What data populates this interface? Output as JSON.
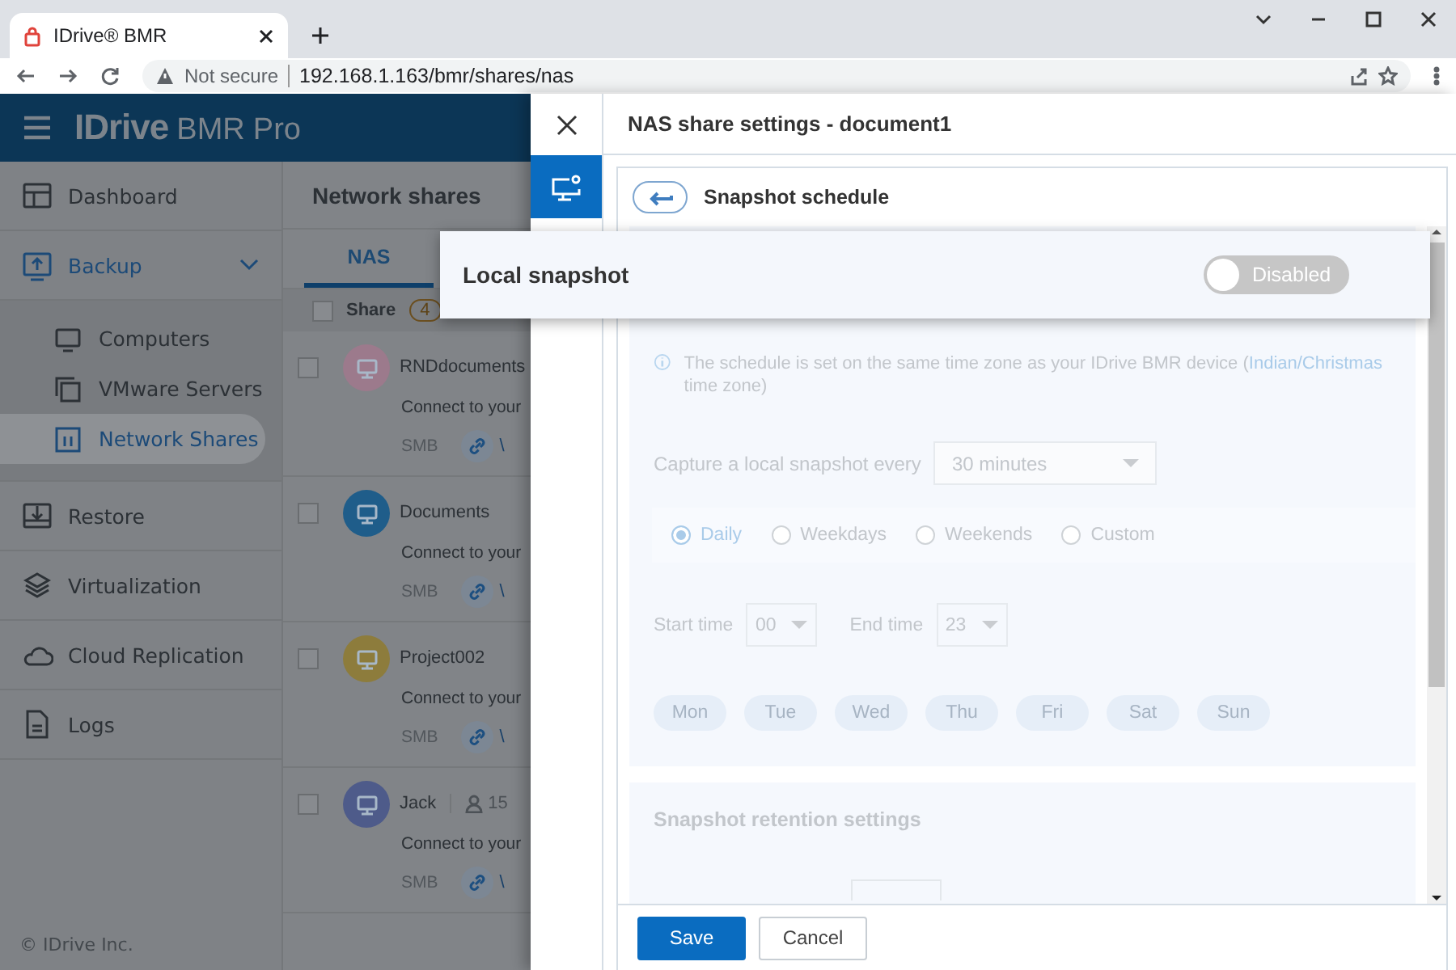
{
  "browser": {
    "tab_title": "IDrive® BMR",
    "security": "Not secure",
    "url": "192.168.1.163/bmr/shares/nas"
  },
  "app": {
    "logo": {
      "brand": "IDrive",
      "product": "BMR",
      "edition": "Pro"
    }
  },
  "sidebar": {
    "items": [
      {
        "label": "Dashboard",
        "selected": false
      },
      {
        "label": "Backup",
        "selected": true,
        "expanded": true,
        "children": [
          {
            "label": "Computers",
            "selected": false
          },
          {
            "label": "VMware Servers",
            "selected": false
          },
          {
            "label": "Network Shares",
            "selected": true
          }
        ]
      },
      {
        "label": "Restore",
        "selected": false
      },
      {
        "label": "Virtualization",
        "selected": false
      },
      {
        "label": "Cloud Replication",
        "selected": false
      },
      {
        "label": "Logs",
        "selected": false
      }
    ],
    "footer": "© IDrive Inc."
  },
  "shares": {
    "title": "Network shares",
    "tabs": [
      {
        "label": "NAS",
        "selected": true
      }
    ],
    "header": {
      "label": "Share",
      "count": "4",
      "checked": false
    },
    "rows": [
      {
        "name": "RNDdocuments",
        "color": "#9c7a8c",
        "checked": false,
        "description": "Connect to your",
        "protocol": "SMB",
        "link": "\\"
      },
      {
        "name": "Documents",
        "color": "#1f5d8a",
        "checked": false,
        "description": "Connect to your",
        "protocol": "SMB",
        "link": "\\"
      },
      {
        "name": "Project002",
        "color": "#8d7c3c",
        "checked": false,
        "description": "Connect to your",
        "protocol": "SMB",
        "link": "\\"
      },
      {
        "name": "Jack",
        "color": "#4e5b8a",
        "checked": false,
        "users": "15",
        "description": "Connect to your",
        "protocol": "SMB",
        "link": "\\"
      }
    ]
  },
  "panel": {
    "title": "NAS share settings - document1",
    "rail": [
      {
        "selected": true
      }
    ],
    "section": "Snapshot schedule",
    "local_snapshot": {
      "label": "Local snapshot",
      "on": false,
      "state_text": "Disabled"
    },
    "info": {
      "text": "The schedule is set on the same time zone as your IDrive BMR device (",
      "link": "Indian/Christmas",
      "after": " time zone)"
    },
    "frequency": {
      "label": "Capture a local snapshot every",
      "value": "30 minutes"
    },
    "schedule_options": [
      {
        "label": "Daily",
        "selected": true
      },
      {
        "label": "Weekdays",
        "selected": false
      },
      {
        "label": "Weekends",
        "selected": false
      },
      {
        "label": "Custom",
        "selected": false
      }
    ],
    "start": {
      "label": "Start time",
      "value": "00"
    },
    "end": {
      "label": "End time",
      "value": "23"
    },
    "days": [
      "Mon",
      "Tue",
      "Wed",
      "Thu",
      "Fri",
      "Sat",
      "Sun"
    ],
    "retention_title": "Snapshot retention settings",
    "buttons": [
      {
        "label": "Save",
        "kind": "primary"
      },
      {
        "label": "Cancel",
        "kind": "secondary"
      }
    ]
  }
}
